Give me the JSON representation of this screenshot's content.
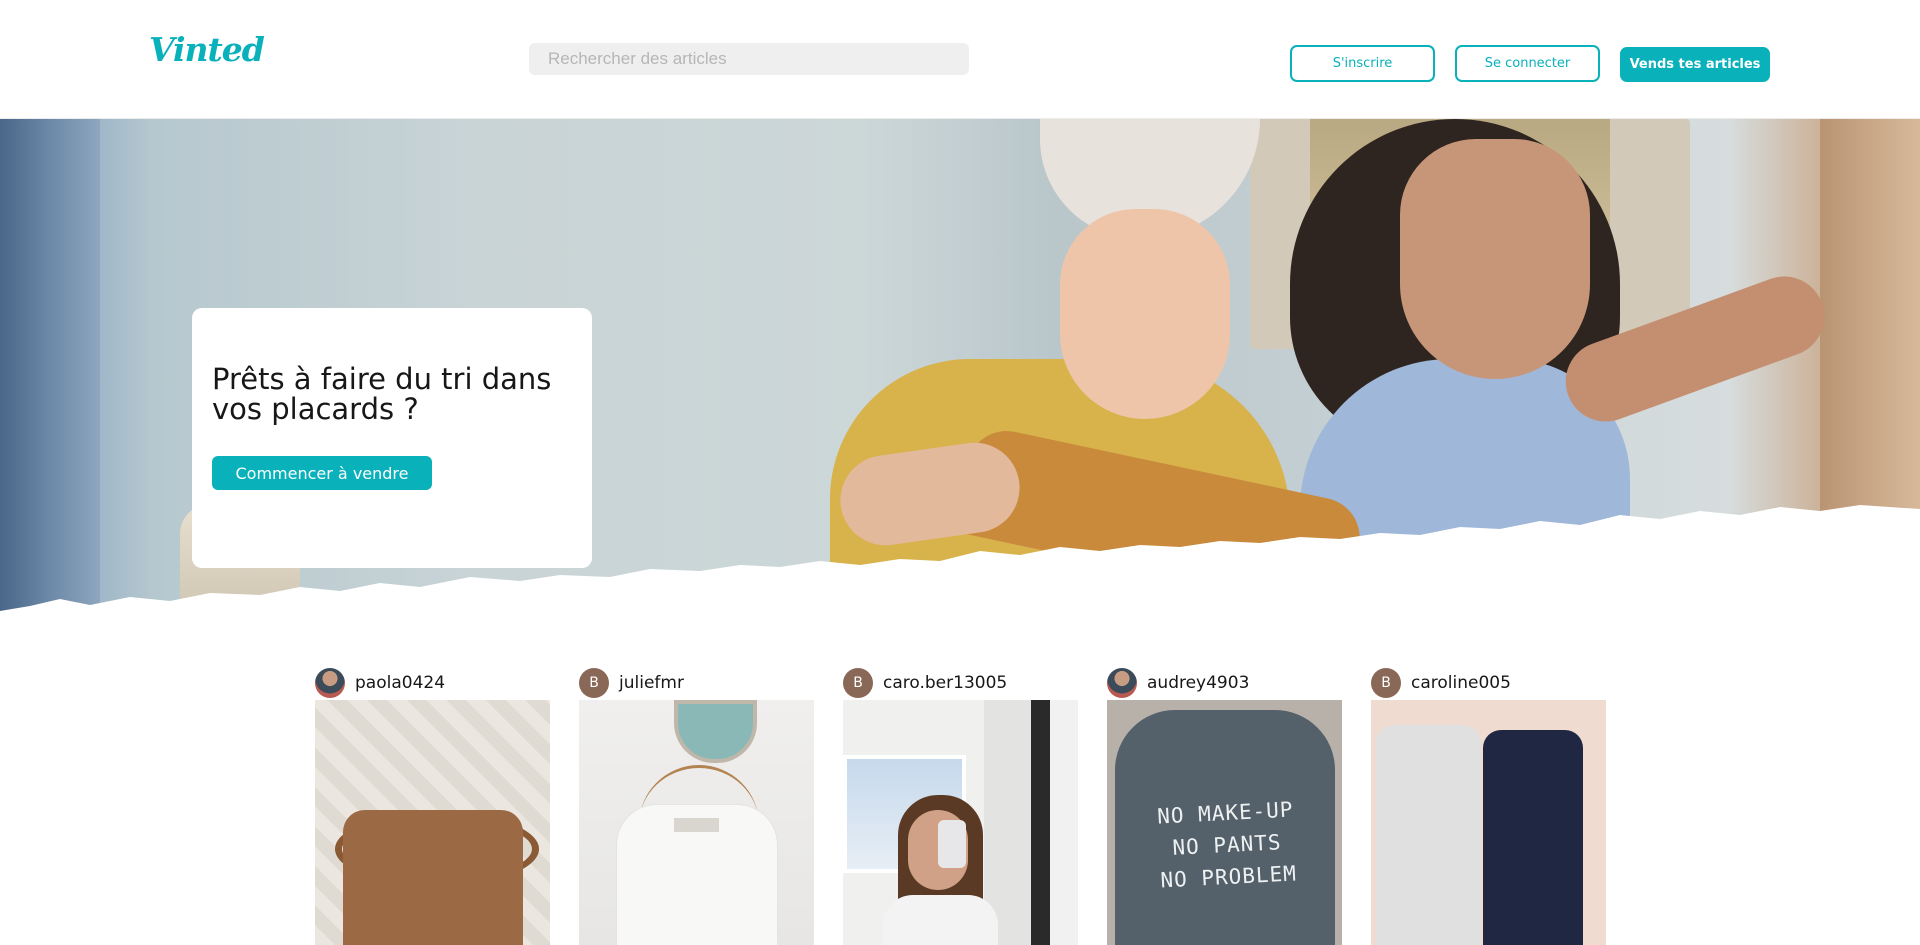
{
  "app": {
    "brand": "Vinted",
    "accent": "#09b1ba"
  },
  "header": {
    "search_placeholder": "Rechercher des articles",
    "signup_label": "S'inscrire",
    "login_label": "Se connecter",
    "sell_label": "Vends tes articles"
  },
  "hero": {
    "title": "Prêts à faire du tri dans vos placards ?",
    "cta_label": "Commencer à vendre"
  },
  "listings": [
    {
      "username": "paola0424",
      "avatar": "photo",
      "avatar_letter": ""
    },
    {
      "username": "juliefmr",
      "avatar": "letter",
      "avatar_letter": "B"
    },
    {
      "username": "caro.ber13005",
      "avatar": "letter",
      "avatar_letter": "B"
    },
    {
      "username": "audrey4903",
      "avatar": "photo",
      "avatar_letter": ""
    },
    {
      "username": "caroline005",
      "avatar": "letter",
      "avatar_letter": "B"
    }
  ],
  "listing_images": {
    "item4_text": [
      "NO MAKE-UP",
      "NO PANTS",
      "NO PROBLEM"
    ]
  }
}
